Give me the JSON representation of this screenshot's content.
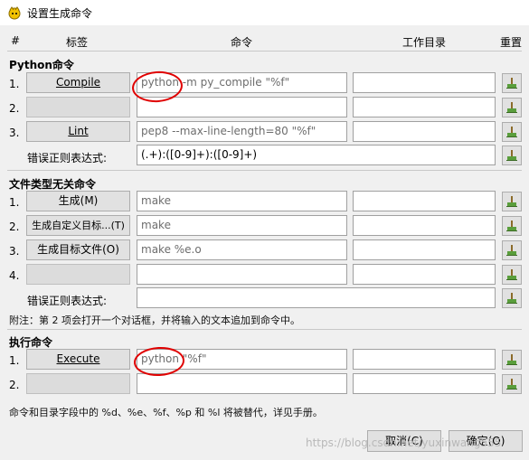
{
  "window": {
    "title": "设置生成命令",
    "icon": "geany-app-icon"
  },
  "columns": {
    "num": "#",
    "label": "标签",
    "command": "命令",
    "workdir": "工作目录",
    "reset": "重置"
  },
  "python_section": {
    "title": "Python命令",
    "rows": [
      {
        "num": "1.",
        "label": "Compile",
        "command": "python -m py_compile \"%f\"",
        "workdir": ""
      },
      {
        "num": "2.",
        "label": "",
        "command": "",
        "workdir": ""
      },
      {
        "num": "3.",
        "label": "Lint",
        "command": "pep8 --max-line-length=80 \"%f\"",
        "workdir": ""
      }
    ],
    "regex_label": "错误正则表达式:",
    "regex_value": "(.+):([0-9]+):([0-9]+)"
  },
  "independent_section": {
    "title": "文件类型无关命令",
    "rows": [
      {
        "num": "1.",
        "label": "生成(M)",
        "command": "make",
        "workdir": ""
      },
      {
        "num": "2.",
        "label": "生成自定义目标...(T)",
        "command": "make",
        "workdir": ""
      },
      {
        "num": "3.",
        "label": "生成目标文件(O)",
        "command": "make %e.o",
        "workdir": ""
      },
      {
        "num": "4.",
        "label": "",
        "command": "",
        "workdir": ""
      }
    ],
    "regex_label": "错误正则表达式:",
    "regex_value": ""
  },
  "note": "附注：第 2 项会打开一个对话框，并将输入的文本追加到命令中。",
  "execute_section": {
    "title": "执行命令",
    "rows": [
      {
        "num": "1.",
        "label": "Execute",
        "command": "python \"%f\"",
        "workdir": ""
      },
      {
        "num": "2.",
        "label": "",
        "command": "",
        "workdir": ""
      }
    ]
  },
  "footer_note": "命令和目录字段中的 %d、%e、%f、%p 和 %l 将被替代，详见手册。",
  "buttons": {
    "cancel": "取消(C)",
    "ok": "确定(O)"
  },
  "watermark": "https://blog.csdn.net/yuxinwang555",
  "reset_icon": "clear-broom-icon",
  "annotation_color": "#e00000"
}
